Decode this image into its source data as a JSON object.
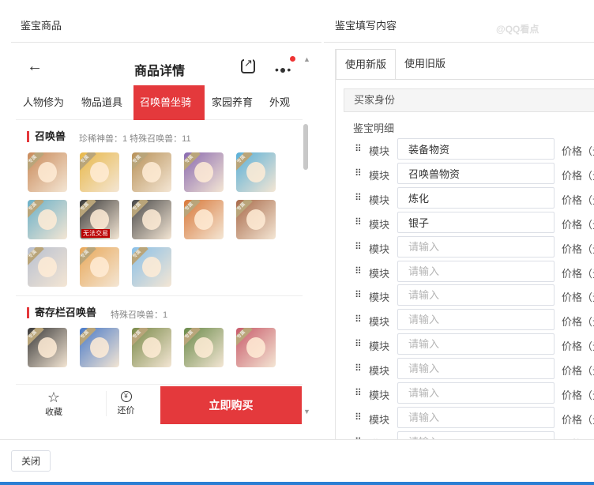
{
  "headers": {
    "left": "鉴宝商品",
    "right": "鉴宝填写内容",
    "watermark": "@QQ看点"
  },
  "phone": {
    "title": "商品详情",
    "back_icon": "back-arrow-icon",
    "tabs": [
      "人物修为",
      "物品道具",
      "召唤兽坐骑",
      "家园养育",
      "外观"
    ],
    "active_tab": "召唤兽坐骑",
    "section1": {
      "title": "召唤兽",
      "stats": "珍稀神兽：1   特殊召唤兽：11"
    },
    "section2": {
      "title": "寄存栏召唤兽",
      "stats": "特殊召唤兽：1"
    },
    "pet_badge": "专属",
    "untradeable_tag": "无法交易",
    "pets1_colors": [
      "#c98a5a",
      "#e8b84a",
      "#b8925a",
      "#8a6ab0",
      "#5ab0d8",
      "#6ab0c8",
      "#3a3a3a",
      "#4a4a4a",
      "#d8783a",
      "#a86a4a",
      "#b8c0d0",
      "#e8a85a",
      "#8ac0e8"
    ],
    "pets2_colors": [
      "#3a3a3a",
      "#4a7ac8",
      "#7a8a4a",
      "#6a8a4a",
      "#c85a6a"
    ],
    "bottom": {
      "fav_label": "收藏",
      "bargain_label": "还价",
      "buy_label": "立即购买"
    }
  },
  "form": {
    "tabs": [
      "使用新版",
      "使用旧版"
    ],
    "active_tab": "使用新版",
    "buyer_label": "买家身份",
    "detail_label": "鉴宝明细",
    "module_label": "模块",
    "price_label": "价格（元）",
    "placeholder": "请输入",
    "rows": [
      {
        "value": "装备物资"
      },
      {
        "value": "召唤兽物资"
      },
      {
        "value": "炼化"
      },
      {
        "value": "银子"
      },
      {
        "value": ""
      },
      {
        "value": ""
      },
      {
        "value": ""
      },
      {
        "value": ""
      },
      {
        "value": ""
      },
      {
        "value": ""
      },
      {
        "value": ""
      },
      {
        "value": ""
      },
      {
        "value": ""
      }
    ]
  },
  "footer": {
    "close_label": "关闭"
  }
}
